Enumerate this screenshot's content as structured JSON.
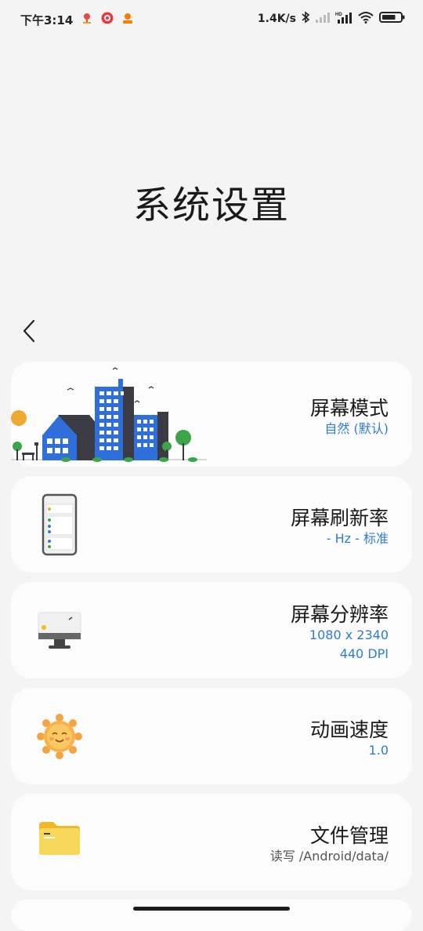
{
  "status_bar": {
    "time": "下午3:14",
    "net_speed": "1.4K/s",
    "battery_level": 0.75
  },
  "page": {
    "title": "系统设置"
  },
  "settings": [
    {
      "title": "屏幕模式",
      "subtitle": "自然 (默认)"
    },
    {
      "title": "屏幕刷新率",
      "subtitle": "- Hz - 标准"
    },
    {
      "title": "屏幕分辨率",
      "subtitle": "1080 x 2340",
      "subtitle2": "440 DPI"
    },
    {
      "title": "动画速度",
      "subtitle": "1.0"
    },
    {
      "title": "文件管理",
      "subtitle": "读写 /Android/data/"
    }
  ],
  "colors": {
    "accent": "#2f7bd8",
    "card_bg": "#fcfcfc",
    "page_bg": "#f4f4f4"
  }
}
